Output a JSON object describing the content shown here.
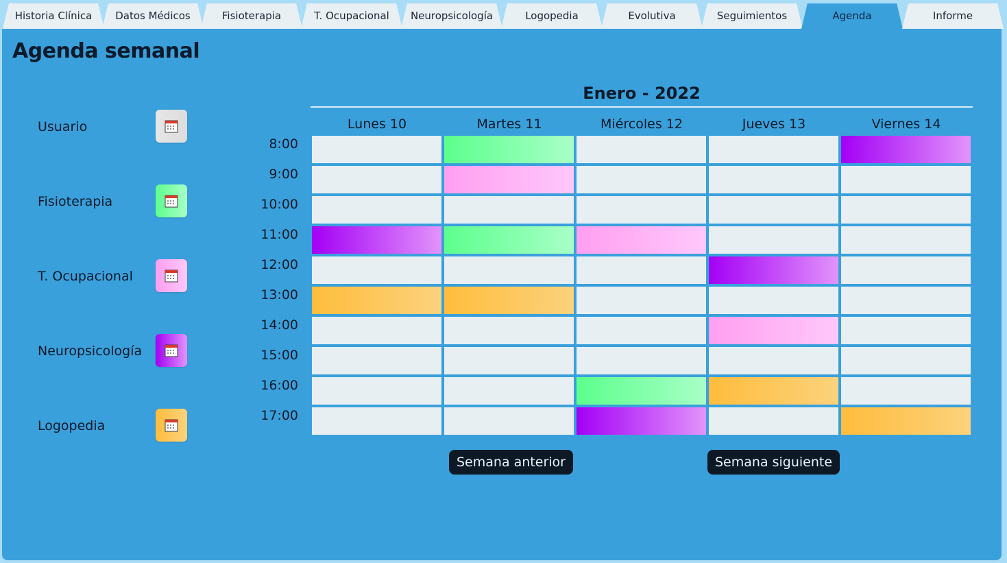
{
  "tabs": [
    {
      "label": "Historia Clínica",
      "active": false
    },
    {
      "label": "Datos Médicos",
      "active": false
    },
    {
      "label": "Fisioterapia",
      "active": false
    },
    {
      "label": "T. Ocupacional",
      "active": false
    },
    {
      "label": "Neuropsicología",
      "active": false
    },
    {
      "label": "Logopedia",
      "active": false
    },
    {
      "label": "Evolutiva",
      "active": false
    },
    {
      "label": "Seguimientos",
      "active": false
    },
    {
      "label": "Agenda",
      "active": true
    },
    {
      "label": "Informe",
      "active": false
    }
  ],
  "page": {
    "title": "Agenda semanal"
  },
  "legend": [
    {
      "label": "Usuario",
      "icon": "calendar-icon",
      "color_from": "#e6e6e6",
      "color_to": "#dcdcdc"
    },
    {
      "label": "Fisioterapia",
      "icon": "calendar-icon",
      "color_from": "#5dff8d",
      "color_to": "#a8ffc7"
    },
    {
      "label": "T. Ocupacional",
      "icon": "calendar-icon",
      "color_from": "#ff9ff0",
      "color_to": "#ffc8fb"
    },
    {
      "label": "Neuropsicología",
      "icon": "calendar-icon",
      "color_from": "#a300f5",
      "color_to": "#e294fb"
    },
    {
      "label": "Logopedia",
      "icon": "calendar-icon",
      "color_from": "#ffbd3d",
      "color_to": "#fbd27c"
    }
  ],
  "agenda": {
    "month": "Enero - 2022",
    "days": [
      "Lunes 10",
      "Martes 11",
      "Miércoles 12",
      "Jueves 13",
      "Viernes 14"
    ],
    "hours": [
      "8:00",
      "9:00",
      "10:00",
      "11:00",
      "12:00",
      "13:00",
      "14:00",
      "15:00",
      "16:00",
      "17:00"
    ],
    "empty_color": "#e7eff2",
    "grid": [
      [
        "",
        "Fisioterapia",
        "",
        "",
        "Neuropsicología"
      ],
      [
        "",
        "T. Ocupacional",
        "",
        "",
        ""
      ],
      [
        "",
        "",
        "",
        "",
        ""
      ],
      [
        "Neuropsicología",
        "Fisioterapia",
        "T. Ocupacional",
        "",
        ""
      ],
      [
        "",
        "",
        "",
        "Neuropsicología",
        ""
      ],
      [
        "Logopedia",
        "Logopedia",
        "",
        "",
        ""
      ],
      [
        "",
        "",
        "",
        "T. Ocupacional",
        ""
      ],
      [
        "",
        "",
        "",
        "",
        ""
      ],
      [
        "",
        "",
        "Fisioterapia",
        "Logopedia",
        ""
      ],
      [
        "",
        "",
        "Neuropsicología",
        "",
        "Logopedia"
      ]
    ]
  },
  "nav": {
    "prev_label": "Semana anterior",
    "next_label": "Semana siguiente"
  }
}
